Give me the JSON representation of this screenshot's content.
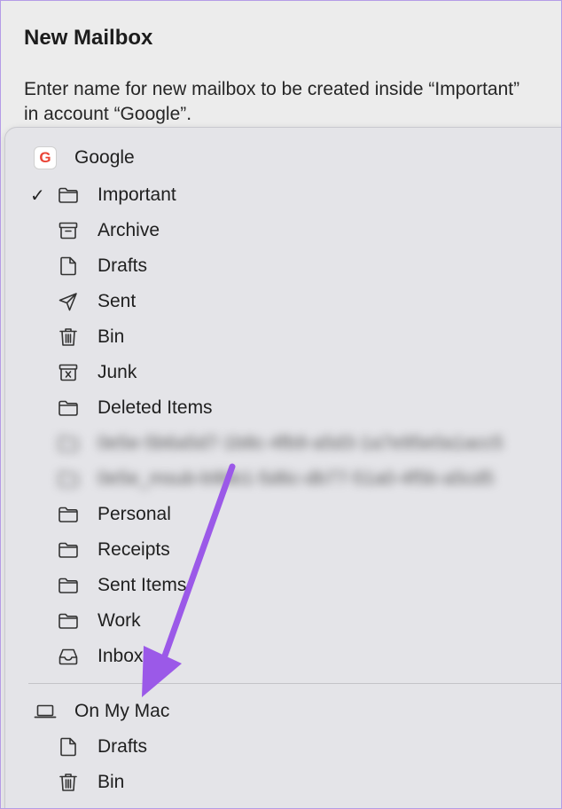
{
  "dialog": {
    "title": "New Mailbox",
    "description": "Enter name for new mailbox to be created inside “Important” in account “Google”."
  },
  "menu": {
    "account_google": {
      "label": "Google",
      "icon": "google-icon",
      "icon_glyph": "G"
    },
    "google_items": [
      {
        "label": "Important",
        "icon": "folder-icon",
        "checked": true
      },
      {
        "label": "Archive",
        "icon": "archive-box-icon"
      },
      {
        "label": "Drafts",
        "icon": "document-icon"
      },
      {
        "label": "Sent",
        "icon": "paper-plane-icon"
      },
      {
        "label": "Bin",
        "icon": "trash-icon"
      },
      {
        "label": "Junk",
        "icon": "junk-box-icon"
      },
      {
        "label": "Deleted Items",
        "icon": "folder-icon"
      },
      {
        "label": "Personal",
        "icon": "folder-icon"
      },
      {
        "label": "Receipts",
        "icon": "folder-icon"
      },
      {
        "label": "Sent Items",
        "icon": "folder-icon"
      },
      {
        "label": "Work",
        "icon": "folder-icon"
      },
      {
        "label": "Inbox",
        "icon": "inbox-tray-icon"
      }
    ],
    "blurred_items": [
      {
        "label": "0e5e-5b6a5d7-1b8c-4fb9-a5d3-1a7e95e0a1acc5"
      },
      {
        "label": "0e5e_msub-b9bb1-5d6c-db77-51a0-4f5b-a5cd5"
      }
    ],
    "account_mac": {
      "label": "On My Mac",
      "icon": "laptop-icon"
    },
    "mac_items": [
      {
        "label": "Drafts",
        "icon": "document-icon"
      },
      {
        "label": "Bin",
        "icon": "trash-icon"
      }
    ],
    "check_glyph": "✓"
  },
  "annotation": {
    "color": "#9b59e8",
    "icon": "arrow-annotation"
  }
}
